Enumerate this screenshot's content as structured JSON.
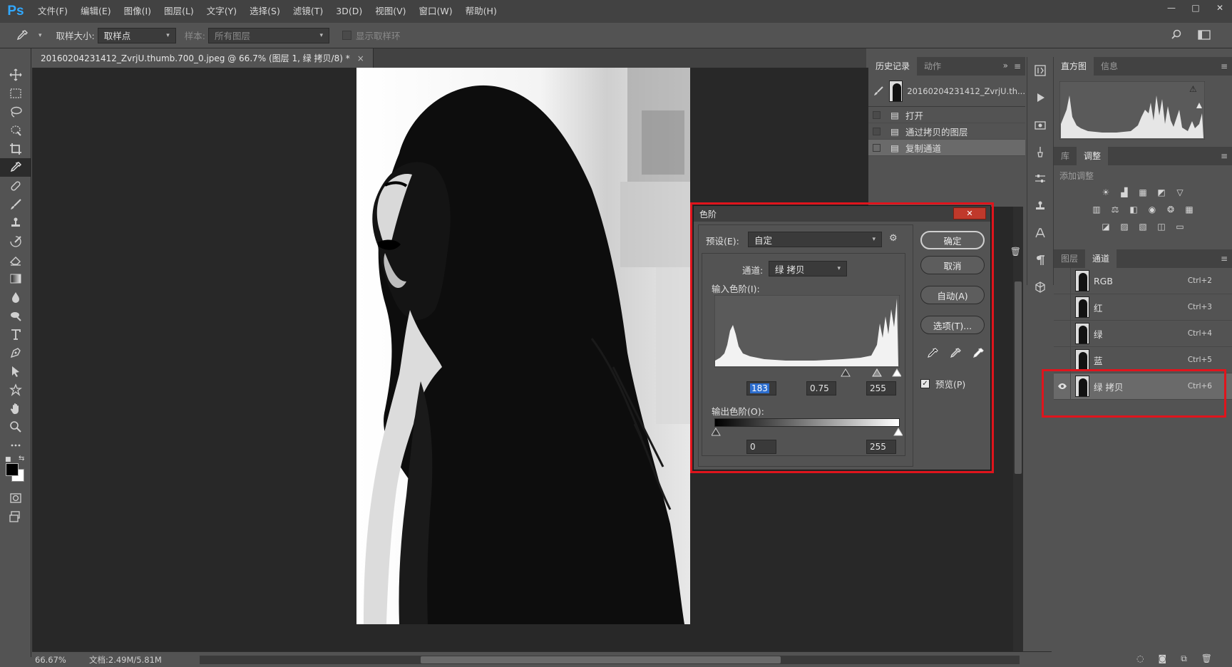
{
  "app": {
    "logo": "Ps"
  },
  "menu": [
    "文件(F)",
    "编辑(E)",
    "图像(I)",
    "图层(L)",
    "文字(Y)",
    "选择(S)",
    "滤镜(T)",
    "3D(D)",
    "视图(V)",
    "窗口(W)",
    "帮助(H)"
  ],
  "window_controls": [
    "—",
    "□",
    "✕"
  ],
  "options": {
    "sample_size_label": "取样大小:",
    "sample_size_value": "取样点",
    "sample_label": "样本:",
    "sample_value": "所有图层",
    "show_ring_label": "显示取样环"
  },
  "document": {
    "tab_title": "20160204231412_ZvrjU.thumb.700_0.jpeg @ 66.7% (图层 1, 绿 拷贝/8) *",
    "tab_close": "×"
  },
  "status": {
    "zoom": "66.67%",
    "doc_info": "文档:2.49M/5.81M",
    "arrow": "›"
  },
  "history_panel": {
    "tabs": [
      "历史记录",
      "动作"
    ],
    "snapshot_name": "20160204231412_ZvrjU.th...",
    "items": [
      "打开",
      "通过拷贝的图层",
      "复制通道"
    ],
    "selected_index": 2
  },
  "histogram_panel": {
    "tabs": [
      "直方图",
      "信息"
    ],
    "warning": "⚠"
  },
  "adjust_panel": {
    "tabs": [
      "库",
      "调整"
    ],
    "add_label": "添加调整"
  },
  "channels_panel": {
    "tabs": [
      "图层",
      "通道"
    ],
    "rows": [
      {
        "name": "RGB",
        "shortcut": "Ctrl+2"
      },
      {
        "name": "红",
        "shortcut": "Ctrl+3"
      },
      {
        "name": "绿",
        "shortcut": "Ctrl+4"
      },
      {
        "name": "蓝",
        "shortcut": "Ctrl+5"
      },
      {
        "name": "绿 拷贝",
        "shortcut": "Ctrl+6"
      }
    ],
    "selected_index": 4
  },
  "levels": {
    "title": "色阶",
    "close": "✕",
    "preset_label": "预设(E):",
    "preset_value": "自定",
    "channel_label": "通道:",
    "channel_value": "绿 拷贝",
    "input_label": "输入色阶(I):",
    "input_black": "183",
    "input_gamma": "0.75",
    "input_white": "255",
    "output_label": "输出色阶(O):",
    "output_black": "0",
    "output_white": "255",
    "btn_ok": "确定",
    "btn_cancel": "取消",
    "btn_auto": "自动(A)",
    "btn_options": "选项(T)...",
    "preview_label": "预览(P)",
    "preview_checked": true
  },
  "colors": {
    "ps_blue": "#31a8ff",
    "highlight_red": "#e0141c",
    "selection_blue": "#2d6ecf"
  }
}
